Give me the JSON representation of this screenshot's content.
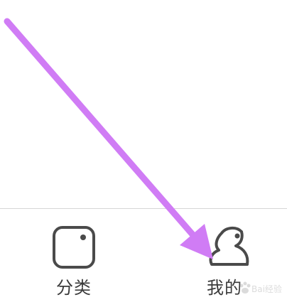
{
  "tabbar": {
    "tabs": [
      {
        "label": "分类",
        "icon": "categories-icon"
      },
      {
        "label": "我的",
        "icon": "profile-icon"
      }
    ]
  },
  "annotation": {
    "arrow_color": "#d07cf5",
    "arrow_points_to": "tab-mine"
  },
  "watermark": {
    "text": "Bai经验"
  },
  "colors": {
    "icon_stroke": "#4a4a4a",
    "label_text": "#3a3a3a",
    "divider": "#d6d6d6"
  }
}
